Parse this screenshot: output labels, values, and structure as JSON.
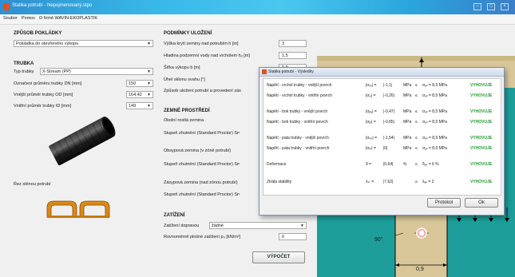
{
  "window": {
    "title": "Statika potrubí - Nepojmenovaný.stpo"
  },
  "menu": {
    "items": [
      "Soubor",
      "Pomoc",
      "O firmě WAVIN-EKOPLASTIK"
    ]
  },
  "left": {
    "laying_title": "ZPŮSOB POKLÁDKY",
    "laying_value": "Pokládka do otevřeného výkopu",
    "pipe_title": "TRUBKA",
    "pipe_type_label": "Typ trubky",
    "pipe_type_value": "X-Stream (PP)",
    "dn_label": "Označení průměru trubky DN [mm]",
    "dn_value": "150",
    "od_label": "Vnější průměr trubky OD [mm]",
    "od_value": "164,42",
    "id_label": "Vnitřní průměr trubky ID [mm]",
    "id_value": "149",
    "section_label": "Řez stěnou potrubí"
  },
  "middle": {
    "conditions_title": "PODMÍNKY ULOŽENÍ",
    "height_label": "Výška krytí zeminy nad potrubím h [m]",
    "height_value": "3",
    "water_label": "Hladina podzemní vody nad vrcholem hₒ [m]",
    "water_value": "1,5",
    "width_label": "Šířka výkopu b [m]",
    "width_value": "0,9",
    "angle_label": "Úhel sklonu svahu [°]",
    "method_label": "Způsob uložení potrubí a provedení zás",
    "soil_title": "ZEMNÉ PROSTŘEDÍ",
    "native_label": "Okolní rostlá zemina",
    "compact1_label": "Stupeň zhutnění (Standard Proctor) Sᴘ",
    "surround_label": "Obsypová zemina (v zóně potrubí)",
    "compact2_label": "Stupeň zhutnění (Standard Proctor) Sᴘ",
    "backfill_label": "Zásypová zemina (nad zónou potrubí)",
    "compact3_label": "Stupeň zhutnění (Standard Proctor) Sᴘ",
    "load_title": "ZATÍŽENÍ",
    "traffic_label": "Zatížení dopravou",
    "traffic_value": "žádné",
    "uniform_label": "Rovnoměrně plošné zatížení p₀ [kN/m²]",
    "uniform_value": "0",
    "calc_button": "VÝPOČET"
  },
  "drawing": {
    "angle_label": "90°",
    "width_label": "0,9"
  },
  "dialog": {
    "title": "Statika potrubí - Výsledky",
    "rows": [
      {
        "name": "Napětí - vrchol trubky - vnější povrch",
        "sym": "|σᵥₑ| =",
        "val": "|-1,1|",
        "unit": "MPa",
        "cmp": "≤",
        "lim": "σₐₗₗ = 8,5 MPa",
        "res": "VYHOVUJE"
      },
      {
        "name": "Napětí - vrchol trubky - vnitřní povrch",
        "sym": "|σᵥᵢ| =",
        "val": "|-0,26|",
        "unit": "MPa",
        "cmp": "≤",
        "lim": "σₐₗₗ = 8,5 MPa",
        "res": "VYHOVUJE"
      },
      {
        "name": "Napětí - bok trubky - vnější povrch",
        "sym": "|σᵦₑ| =",
        "val": "|-0,47|",
        "unit": "MPa",
        "cmp": "≤",
        "lim": "σₐₗₗ = 8,5 MPa",
        "res": "VYHOVUJE"
      },
      {
        "name": "Napětí - bok trubky - vnitřní povrch",
        "sym": "|σᵦᵢ| =",
        "val": "|-0,85|",
        "unit": "MPa",
        "cmp": "≤",
        "lim": "σₐₗₗ = 8,5 MPa",
        "res": "VYHOVUJE"
      },
      {
        "name": "Napětí - pata trubky - vnější povrch",
        "sym": "|σₚₑ| =",
        "val": "|-1,54|",
        "unit": "MPa",
        "cmp": "≤",
        "lim": "σₐₗₗ = 8,5 MPa",
        "res": "VYHOVUJE"
      },
      {
        "name": "Napětí - pata trubky - vnitřní povrch",
        "sym": "|σₚᵢ| =",
        "val": "|0|",
        "unit": "MPa",
        "cmp": "≤",
        "lim": "σₐₗₗ = 8,5 MPa",
        "res": "VYHOVUJE"
      },
      {
        "name": "Deformace",
        "sym": "δ =",
        "val": "|0,64|",
        "unit": "%",
        "cmp": "≤",
        "lim": "δₐₗₗ = 6 %",
        "res": "VYHOVUJE"
      },
      {
        "name": "Ztráta stability",
        "sym": "λₛₜ =",
        "val": "|7,62|",
        "unit": "",
        "cmp": "≥",
        "lim": "λₐₗₗ = 2",
        "res": "VYHOVUJE"
      }
    ],
    "protocol_button": "Protokol",
    "ok_button": "Ok"
  },
  "colors": {
    "accent_ok": "#1f9a2a",
    "canvas": "#1d9e9a",
    "soil": "#d9c79a",
    "titlebar": "#38b8e8"
  }
}
